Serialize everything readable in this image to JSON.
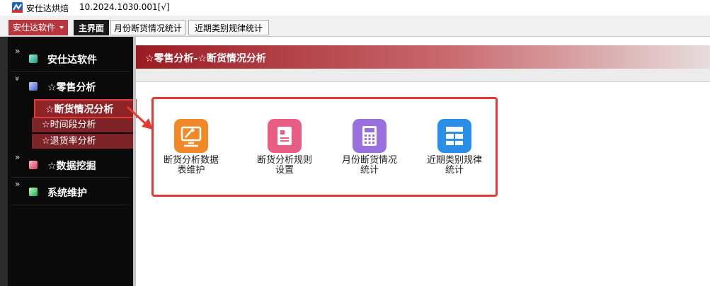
{
  "window": {
    "title": "安仕达烘焙",
    "version": "10.2024.1030.001[√]"
  },
  "tabbar": {
    "brand_menu": "安仕达软件",
    "tabs": [
      {
        "label": "主界面"
      },
      {
        "label": "月份断货情况统计"
      },
      {
        "label": "近期类别规律统计"
      }
    ]
  },
  "sidebar": {
    "sections": [
      {
        "label": "安仕达软件",
        "chevron": "»",
        "icon": "teal-cube-icon",
        "color": "#37c8a2"
      },
      {
        "label": "☆零售分析",
        "chevron": "»",
        "icon": "blue-cube-icon",
        "color": "#6a86d8",
        "items": [
          {
            "label": "☆断货情况分析"
          },
          {
            "label": "☆时间段分析"
          },
          {
            "label": "☆退货率分析"
          }
        ]
      },
      {
        "label": "☆数据挖掘",
        "chevron": "»",
        "icon": "red-cube-icon",
        "color": "#e06070"
      },
      {
        "label": "系统维护",
        "chevron": "»",
        "icon": "green-cube-icon",
        "color": "#4cc866"
      }
    ]
  },
  "content": {
    "title": "☆零售分析-☆断货情况分析"
  },
  "tiles": [
    {
      "label": "断货分析数据表维护",
      "icon": "monitor-wrench-icon",
      "color": "#f08a28"
    },
    {
      "label": "断货分析规则设置",
      "icon": "clipboard-icon",
      "color": "#e95c84"
    },
    {
      "label": "月份断货情况统计",
      "icon": "calculator-icon",
      "color": "#9a6fe0"
    },
    {
      "label": "近期类别规律统计",
      "icon": "list-grid-icon",
      "color": "#2a8fe8"
    }
  ],
  "colors": {
    "accent": "#b8373e",
    "highlight": "#e53935",
    "sidebar_bg": "#0a0a0a"
  }
}
